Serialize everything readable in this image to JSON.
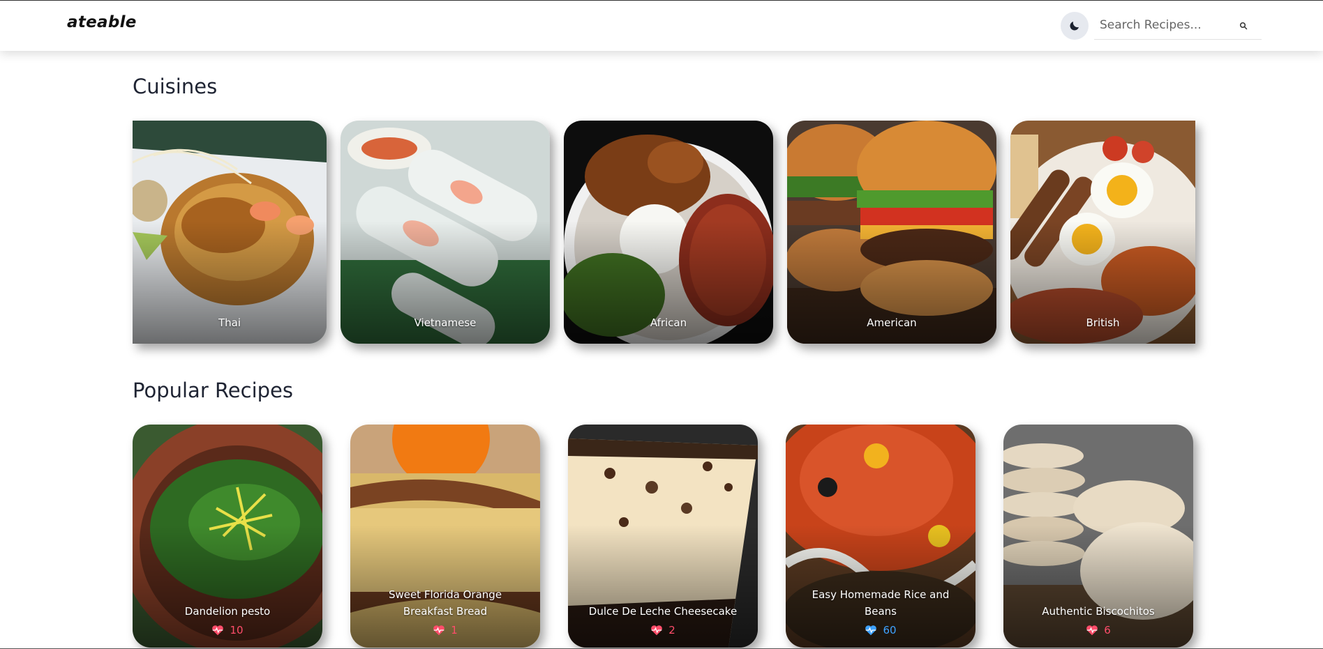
{
  "header": {
    "logo": "ateable",
    "theme_toggle_icon": "moon-icon",
    "search": {
      "placeholder": "Search Recipes...",
      "value": "",
      "icon": "search-icon"
    }
  },
  "cuisines": {
    "title": "Cuisines",
    "items": [
      {
        "label": "Thai"
      },
      {
        "label": "Vietnamese"
      },
      {
        "label": "African"
      },
      {
        "label": "American"
      },
      {
        "label": "British"
      }
    ]
  },
  "popular": {
    "title": "Popular Recipes",
    "items": [
      {
        "label": "Dandelion pesto",
        "likes": "10",
        "like_color": "#ff4d6a"
      },
      {
        "label": "Sweet Florida Orange Breakfast Bread",
        "likes": "1",
        "like_color": "#ff4d6a"
      },
      {
        "label": "Dulce De Leche Cheesecake",
        "likes": "2",
        "like_color": "#ff4d6a"
      },
      {
        "label": "Easy Homemade Rice and Beans",
        "likes": "60",
        "like_color": "#3ea2ff"
      },
      {
        "label": "Authentic Biscochitos",
        "likes": "6",
        "like_color": "#ff4d6a"
      }
    ]
  }
}
